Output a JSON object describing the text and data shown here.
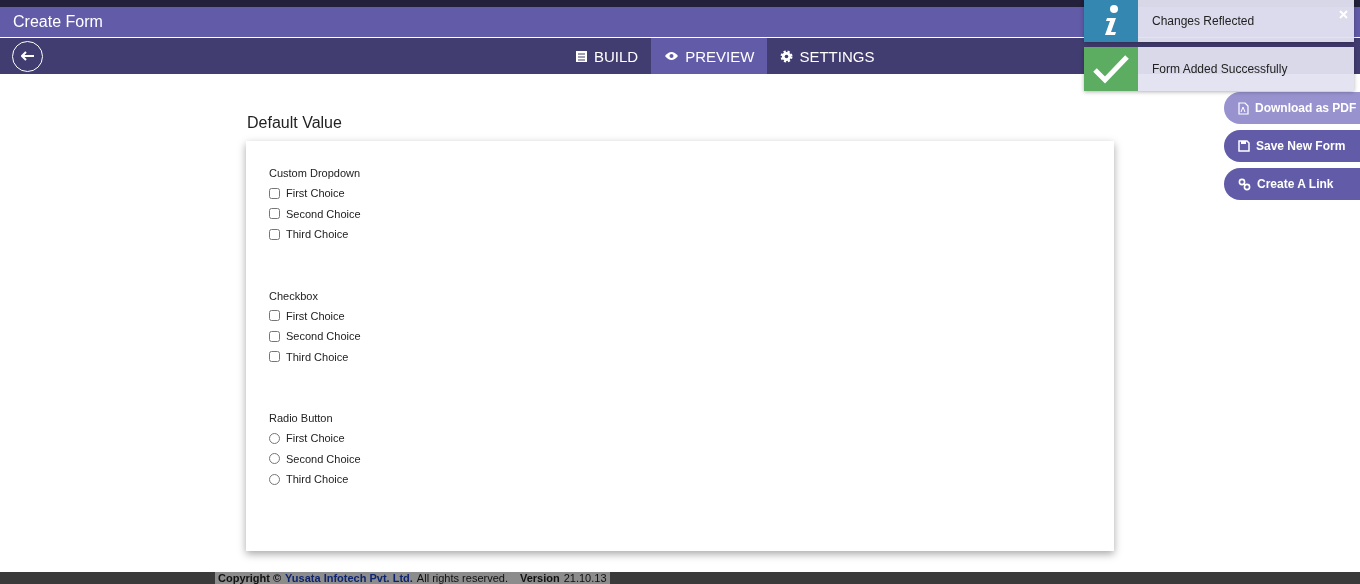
{
  "header": {
    "title": "Create Form"
  },
  "tabs": [
    {
      "label": "BUILD",
      "selected": false
    },
    {
      "label": "PREVIEW",
      "selected": true
    },
    {
      "label": "SETTINGS",
      "selected": false
    }
  ],
  "form": {
    "title": "Default Value",
    "fields": [
      {
        "label": "Custom Dropdown",
        "kind": "checkbox",
        "options": [
          {
            "label": "First Choice",
            "checked": false
          },
          {
            "label": "Second Choice",
            "checked": false
          },
          {
            "label": "Third Choice",
            "checked": false
          }
        ]
      },
      {
        "label": "Checkbox",
        "kind": "checkbox",
        "options": [
          {
            "label": "First Choice",
            "checked": false
          },
          {
            "label": "Second Choice",
            "checked": false
          },
          {
            "label": "Third Choice",
            "checked": false
          }
        ]
      },
      {
        "label": "Radio Button",
        "kind": "radio",
        "options": [
          {
            "label": "First Choice",
            "checked": false
          },
          {
            "label": "Second Choice",
            "checked": false
          },
          {
            "label": "Third Choice",
            "checked": false
          }
        ]
      }
    ]
  },
  "actions": [
    {
      "label": "Download as PDF"
    },
    {
      "label": "Save New Form"
    },
    {
      "label": "Create A Link"
    }
  ],
  "toasts": [
    {
      "kind": "info",
      "message": "Changes Reflected",
      "closable": true
    },
    {
      "kind": "success",
      "message": "Form Added Successfully",
      "closable": false
    }
  ],
  "footer": {
    "copyright": "Copyright ©",
    "company": "Yusata Infotech Pvt. Ltd.",
    "rights": "All rights reserved.",
    "version_label": "Version",
    "version": "21.10.13"
  }
}
